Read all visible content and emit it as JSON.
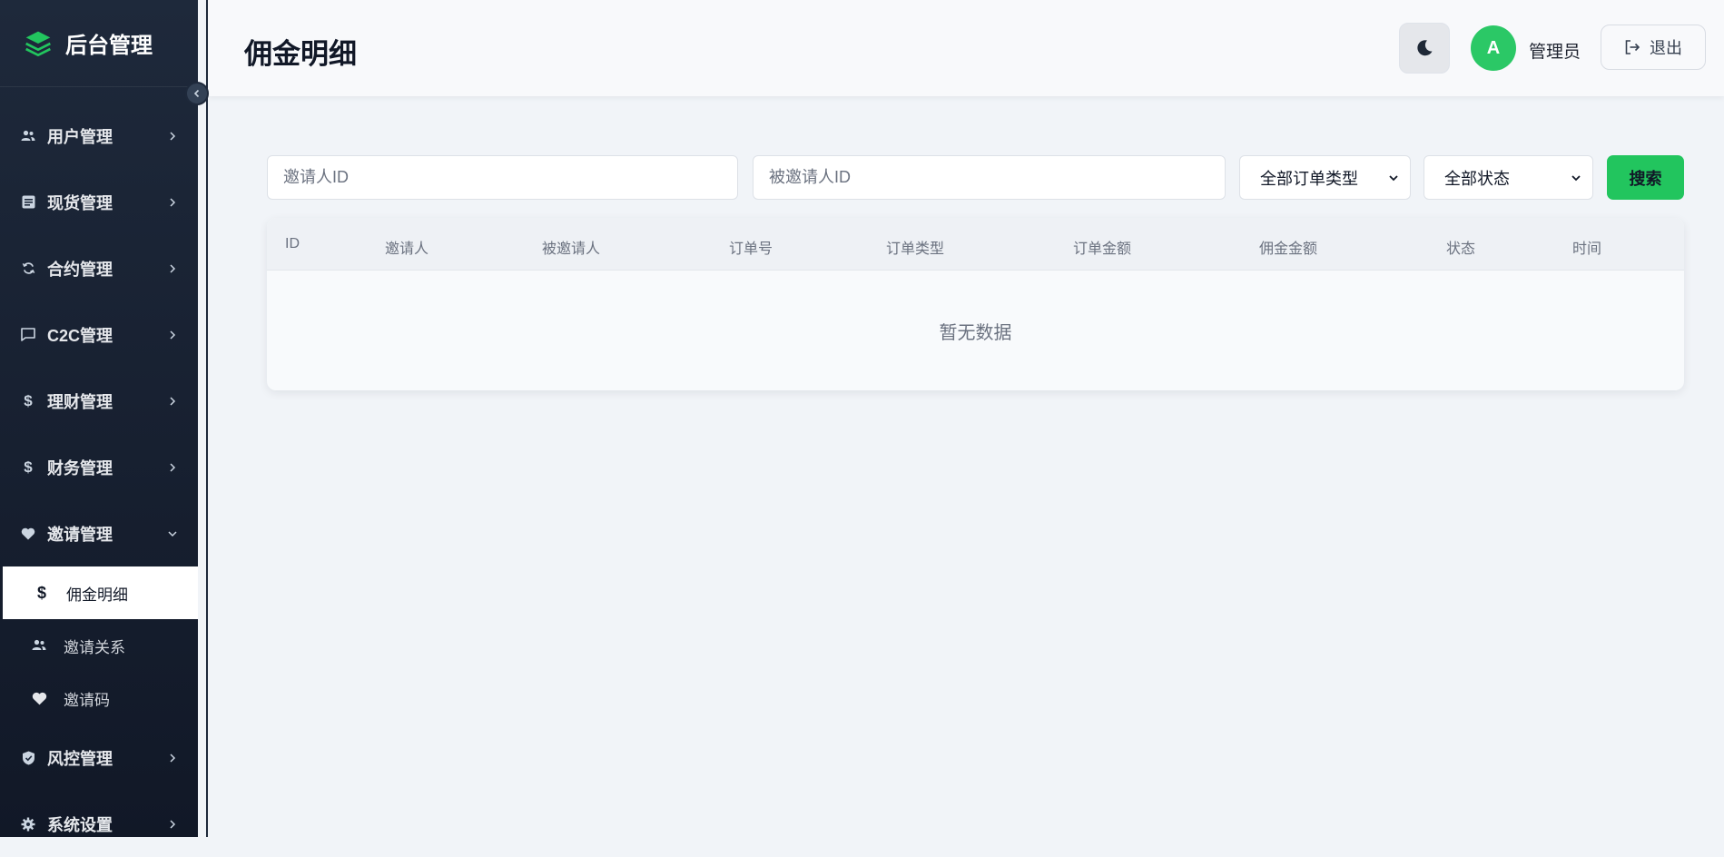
{
  "sidebar": {
    "brand_title": "后台管理",
    "items": [
      {
        "label": "用户管理",
        "icon": "users-icon"
      },
      {
        "label": "现货管理",
        "icon": "list-icon"
      },
      {
        "label": "合约管理",
        "icon": "refresh-icon"
      },
      {
        "label": "C2C管理",
        "icon": "chat-icon"
      },
      {
        "label": "理财管理",
        "icon": "dollar-icon"
      },
      {
        "label": "财务管理",
        "icon": "dollar-icon"
      },
      {
        "label": "邀请管理",
        "icon": "heart-icon",
        "expanded": true
      },
      {
        "label": "风控管理",
        "icon": "shield-icon"
      },
      {
        "label": "系统设置",
        "icon": "gear-icon"
      }
    ],
    "sub_items": [
      {
        "label": "佣金明细",
        "icon": "dollar-icon",
        "active": true
      },
      {
        "label": "邀请关系",
        "icon": "users-icon"
      },
      {
        "label": "邀请码",
        "icon": "heart-icon"
      }
    ]
  },
  "header": {
    "title": "佣金明细",
    "avatar_letter": "A",
    "user_name": "管理员",
    "logout_label": "退出"
  },
  "filters": {
    "inviter_placeholder": "邀请人ID",
    "invitee_placeholder": "被邀请人ID",
    "order_type_selected": "全部订单类型",
    "status_selected": "全部状态",
    "search_label": "搜索"
  },
  "table": {
    "columns": [
      "ID",
      "邀请人",
      "被邀请人",
      "订单号",
      "订单类型",
      "订单金额",
      "佣金金额",
      "状态",
      "时间"
    ],
    "empty_text": "暂无数据"
  },
  "colors": {
    "accent": "#22c55e",
    "sidebar_bg": "#1e293b",
    "avatar_bg": "#2bc866"
  }
}
